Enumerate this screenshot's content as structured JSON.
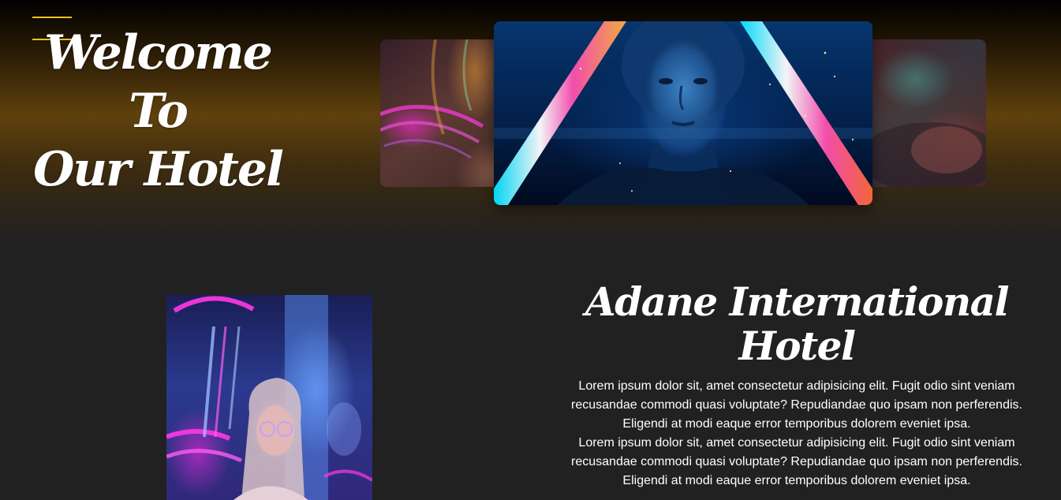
{
  "header": {
    "menu_icon": "hamburger-menu-icon",
    "menu_color": "#f2c21a",
    "welcome_lines": [
      "Welcome",
      "To",
      "Our Hotel"
    ]
  },
  "carousel": {
    "slides": [
      {
        "position": "left",
        "image": "neon-light-trails-photo"
      },
      {
        "position": "center",
        "image": "woman-neon-triangle-portrait"
      },
      {
        "position": "right",
        "image": "red-teal-blurred-photo"
      }
    ]
  },
  "about": {
    "image": "woman-neon-glasses-portrait",
    "title": "Adane International Hotel",
    "paragraphs": [
      "Lorem ipsum dolor sit, amet consectetur adipisicing elit. Fugit odio sint veniam recusandae commodi quasi voluptate? Repudiandae quo ipsam non perferendis. Eligendi at modi eaque error temporibus dolorem eveniet ipsa.",
      "Lorem ipsum dolor sit, amet consectetur adipisicing elit. Fugit odio sint veniam recusandae commodi quasi voluptate? Repudiandae quo ipsam non perferendis. Eligendi at modi eaque error temporibus dolorem eveniet ipsa."
    ]
  },
  "colors": {
    "page_background": "#212121",
    "hero_glow": "#5f410d",
    "text": "#ffffff"
  }
}
